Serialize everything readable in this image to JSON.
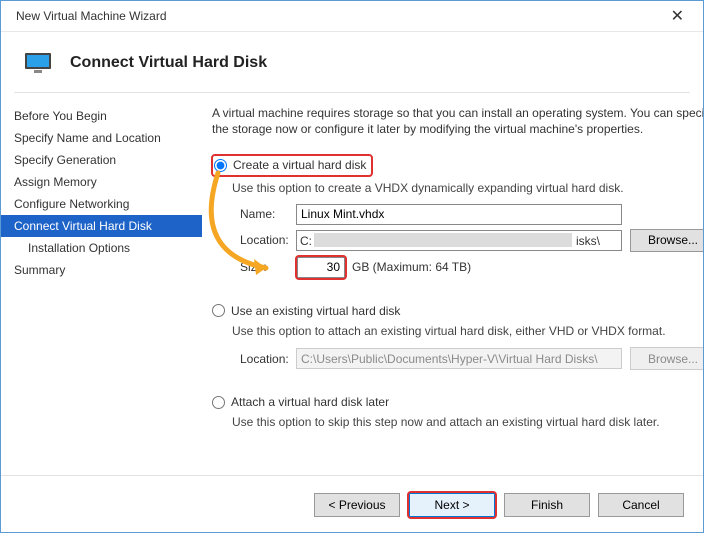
{
  "window": {
    "title": "New Virtual Machine Wizard"
  },
  "header": {
    "title": "Connect Virtual Hard Disk"
  },
  "sidebar": {
    "items": [
      {
        "label": "Before You Begin"
      },
      {
        "label": "Specify Name and Location"
      },
      {
        "label": "Specify Generation"
      },
      {
        "label": "Assign Memory"
      },
      {
        "label": "Configure Networking"
      },
      {
        "label": "Connect Virtual Hard Disk"
      },
      {
        "label": "Installation Options"
      },
      {
        "label": "Summary"
      }
    ]
  },
  "content": {
    "intro": "A virtual machine requires storage so that you can install an operating system. You can specify the storage now or configure it later by modifying the virtual machine's properties.",
    "opt1": {
      "label": "Create a virtual hard disk",
      "desc": "Use this option to create a VHDX dynamically expanding virtual hard disk.",
      "name_label": "Name:",
      "name_value": "Linux Mint.vhdx",
      "location_label": "Location:",
      "location_prefix": "C:",
      "location_suffix": "isks\\",
      "browse": "Browse...",
      "size_label": "Size:",
      "size_value": "30",
      "size_unit": "GB (Maximum: 64 TB)"
    },
    "opt2": {
      "label": "Use an existing virtual hard disk",
      "desc": "Use this option to attach an existing virtual hard disk, either VHD or VHDX format.",
      "location_label": "Location:",
      "location_value": "C:\\Users\\Public\\Documents\\Hyper-V\\Virtual Hard Disks\\",
      "browse": "Browse..."
    },
    "opt3": {
      "label": "Attach a virtual hard disk later",
      "desc": "Use this option to skip this step now and attach an existing virtual hard disk later."
    }
  },
  "footer": {
    "previous": "< Previous",
    "next": "Next >",
    "finish": "Finish",
    "cancel": "Cancel"
  }
}
